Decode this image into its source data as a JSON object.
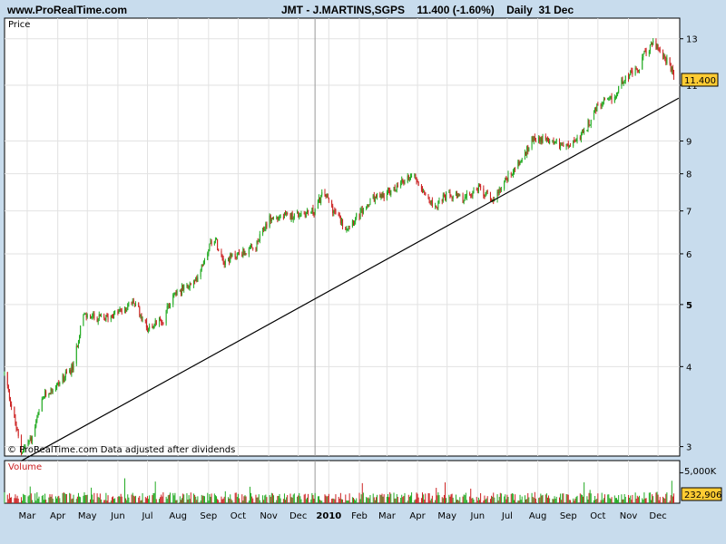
{
  "header": {
    "site": "www.ProRealTime.com",
    "symbol": "JMT - J.MARTINS,SGPS",
    "quote": "11.400 (-1.60%)",
    "period": "Daily",
    "date": "31 Dec"
  },
  "price_panel": {
    "label": "Price",
    "note": "© ProRealTime.com  Data adjusted after dividends",
    "last_badge": "11.400"
  },
  "volume_panel": {
    "label": "Volume",
    "scale_label": "5,000K",
    "last_badge": "232,906"
  },
  "colors": {
    "background": "#c8dced",
    "panel": "#ffffff",
    "up": "#22aa22",
    "down": "#cc2222",
    "badge": "#ffcc33"
  },
  "chart_data": {
    "type": "candlestick",
    "y_scale": "log",
    "ylim": [
      2.9,
      14
    ],
    "y_ticks": [
      {
        "value": 3,
        "label": "3"
      },
      {
        "value": 4,
        "label": "4"
      },
      {
        "value": 5,
        "label": "5"
      },
      {
        "value": 6,
        "label": "6"
      },
      {
        "value": 7,
        "label": "7"
      },
      {
        "value": 8,
        "label": "8"
      },
      {
        "value": 9,
        "label": "9"
      },
      {
        "value": 11,
        "label": "11"
      },
      {
        "value": 13,
        "label": "13"
      }
    ],
    "x_ticks": [
      "Mar",
      "Apr",
      "May",
      "Jun",
      "Jul",
      "Aug",
      "Sep",
      "Oct",
      "Nov",
      "Dec",
      "2010",
      "Feb",
      "Mar",
      "Apr",
      "May",
      "Jun",
      "Jul",
      "Aug",
      "Sep",
      "Oct",
      "Nov",
      "Dec"
    ],
    "price_path": [
      [
        "2009-02-20",
        3.9
      ],
      [
        "2009-03-01",
        3.35
      ],
      [
        "2009-03-09",
        2.95
      ],
      [
        "2009-03-20",
        3.1
      ],
      [
        "2009-04-01",
        3.6
      ],
      [
        "2009-04-15",
        3.75
      ],
      [
        "2009-05-01",
        4.0
      ],
      [
        "2009-05-10",
        4.8
      ],
      [
        "2009-06-01",
        4.75
      ],
      [
        "2009-06-20",
        4.9
      ],
      [
        "2009-07-01",
        5.05
      ],
      [
        "2009-07-15",
        4.6
      ],
      [
        "2009-08-01",
        4.75
      ],
      [
        "2009-08-10",
        5.2
      ],
      [
        "2009-09-01",
        5.4
      ],
      [
        "2009-09-20",
        6.4
      ],
      [
        "2009-10-01",
        5.85
      ],
      [
        "2009-10-15",
        6.0
      ],
      [
        "2009-11-01",
        6.1
      ],
      [
        "2009-11-15",
        6.8
      ],
      [
        "2009-12-01",
        6.85
      ],
      [
        "2009-12-31",
        7.0
      ],
      [
        "2010-01-10",
        7.5
      ],
      [
        "2010-01-20",
        7.0
      ],
      [
        "2010-02-01",
        6.6
      ],
      [
        "2010-02-15",
        6.9
      ],
      [
        "2010-03-01",
        7.3
      ],
      [
        "2010-03-20",
        7.5
      ],
      [
        "2010-04-10",
        8.0
      ],
      [
        "2010-04-20",
        7.6
      ],
      [
        "2010-05-01",
        7.1
      ],
      [
        "2010-05-15",
        7.4
      ],
      [
        "2010-06-01",
        7.3
      ],
      [
        "2010-06-15",
        7.6
      ],
      [
        "2010-07-01",
        7.3
      ],
      [
        "2010-07-15",
        7.9
      ],
      [
        "2010-08-01",
        8.5
      ],
      [
        "2010-08-10",
        9.1
      ],
      [
        "2010-09-01",
        9.0
      ],
      [
        "2010-09-15",
        8.8
      ],
      [
        "2010-10-01",
        9.3
      ],
      [
        "2010-10-15",
        10.2
      ],
      [
        "2010-11-01",
        10.5
      ],
      [
        "2010-11-10",
        11.3
      ],
      [
        "2010-11-25",
        11.6
      ],
      [
        "2010-12-01",
        12.3
      ],
      [
        "2010-12-10",
        12.8
      ],
      [
        "2010-12-20",
        12.3
      ],
      [
        "2010-12-31",
        11.4
      ]
    ],
    "trendline": [
      [
        "2009-03-09",
        2.85
      ],
      [
        "2011-01-05",
        10.5
      ]
    ],
    "volume_ylim": [
      0,
      7000000
    ],
    "volume_tick": 5000000,
    "last_close": 11.4,
    "last_volume": 232906
  }
}
